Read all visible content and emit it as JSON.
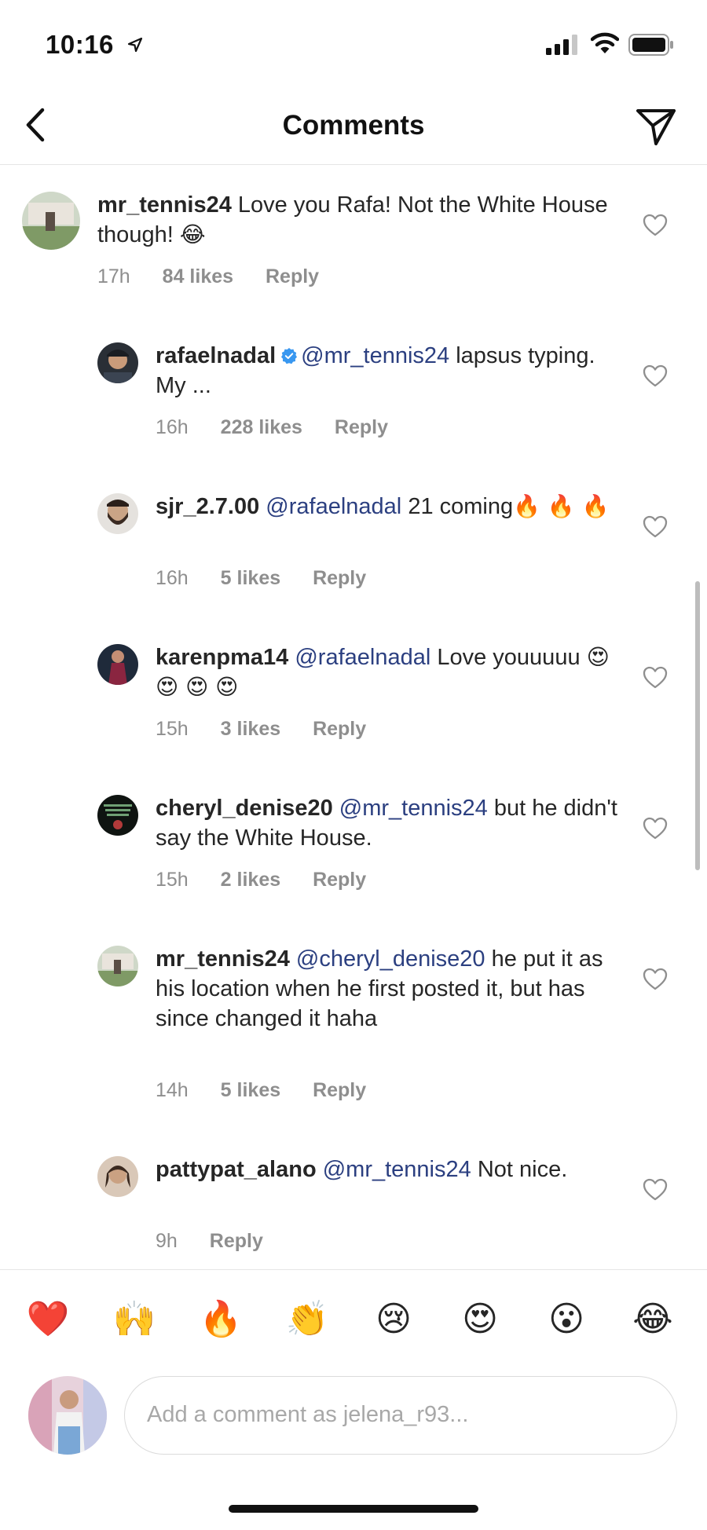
{
  "status_bar": {
    "time": "10:16"
  },
  "nav": {
    "title": "Comments"
  },
  "comments": [
    {
      "username": "mr_tennis24",
      "verified": false,
      "text": "Love you Rafa! Not the White House though!",
      "emoji": "😂",
      "time": "17h",
      "likes": "84 likes",
      "reply": "Reply"
    },
    {
      "username": "rafaelnadal",
      "verified": true,
      "mention": "@mr_tennis24",
      "text": "lapsus typing. My ...",
      "time": "16h",
      "likes": "228 likes",
      "reply": "Reply"
    },
    {
      "username": "sjr_2.7.00",
      "verified": false,
      "mention": "@rafaelnadal",
      "text": "21 coming",
      "emoji": "🔥 🔥 🔥",
      "time": "16h",
      "likes": "5 likes",
      "reply": "Reply"
    },
    {
      "username": "karenpma14",
      "verified": false,
      "mention": "@rafaelnadal",
      "text": "Love youuuuu",
      "emoji": "😍 😍 😍 😍",
      "time": "15h",
      "likes": "3 likes",
      "reply": "Reply"
    },
    {
      "username": "cheryl_denise20",
      "verified": false,
      "mention": "@mr_tennis24",
      "text": "but he didn't say the White House.",
      "time": "15h",
      "likes": "2 likes",
      "reply": "Reply"
    },
    {
      "username": "mr_tennis24",
      "verified": false,
      "mention": "@cheryl_denise20",
      "text": "he put it as his location when he first posted it, but has since changed it haha",
      "time": "14h",
      "likes": "5 likes",
      "reply": "Reply"
    },
    {
      "username": "pattypat_alano",
      "verified": false,
      "mention": "@mr_tennis24",
      "text": "Not nice.",
      "time": "9h",
      "reply": "Reply"
    }
  ],
  "quick_reactions": [
    "❤️",
    "🙌",
    "🔥",
    "👏",
    "😢",
    "😍",
    "😮",
    "😂"
  ],
  "composer": {
    "placeholder": "Add a comment as jelena_r93..."
  },
  "colors": {
    "mention": "#2b3f80",
    "muted": "#8e8e8e",
    "verified": "#3897f0",
    "heart_red": "#ed4956"
  }
}
